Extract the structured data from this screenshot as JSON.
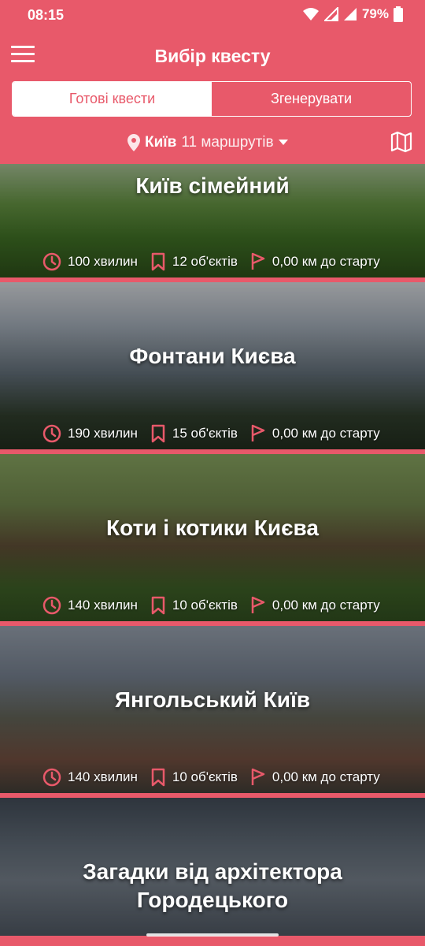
{
  "status": {
    "time": "08:15",
    "battery": "79%"
  },
  "header": {
    "title": "Вибір квесту"
  },
  "tabs": [
    {
      "label": "Готові квести"
    },
    {
      "label": "Згенерувати"
    }
  ],
  "city": {
    "name": "Київ",
    "count": "11 маршрутів"
  },
  "colors": {
    "accent": "#e8596a"
  },
  "quests": [
    {
      "title": "Київ сімейний",
      "duration": "100 хвилин",
      "objects": "12 об'єктів",
      "distance": "0,00 км до старту"
    },
    {
      "title": "Фонтани Києва",
      "duration": "190 хвилин",
      "objects": "15 об'єктів",
      "distance": "0,00 км до старту"
    },
    {
      "title": "Коти і котики Києва",
      "duration": "140 хвилин",
      "objects": "10 об'єктів",
      "distance": "0,00 км до старту"
    },
    {
      "title": "Янгольський Київ",
      "duration": "140 хвилин",
      "objects": "10 об'єктів",
      "distance": "0,00 км до старту"
    },
    {
      "title": "Загадки від архітектора Городецького"
    }
  ]
}
